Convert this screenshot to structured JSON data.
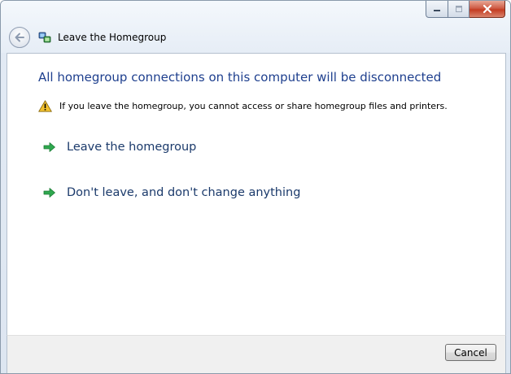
{
  "window": {
    "breadcrumb_title": "Leave the Homegroup",
    "caption_buttons": [
      "minimize-icon",
      "maximize-icon",
      "close-icon"
    ]
  },
  "main": {
    "heading": "All homegroup connections on this computer will be disconnected",
    "warning": {
      "icon": "warning-icon",
      "text": "If you leave the homegroup, you cannot access or share homegroup files and printers."
    },
    "commands": [
      {
        "label": "Leave the homegroup",
        "icon": "green-arrow-icon"
      },
      {
        "label": "Don't leave, and don't change anything",
        "icon": "green-arrow-icon"
      }
    ]
  },
  "footer": {
    "cancel_label": "Cancel"
  },
  "colors": {
    "heading": "#1e3f8e",
    "command_text": "#1b3a6b",
    "arrow": "#2fa84f",
    "warning": "#f2c12e"
  }
}
